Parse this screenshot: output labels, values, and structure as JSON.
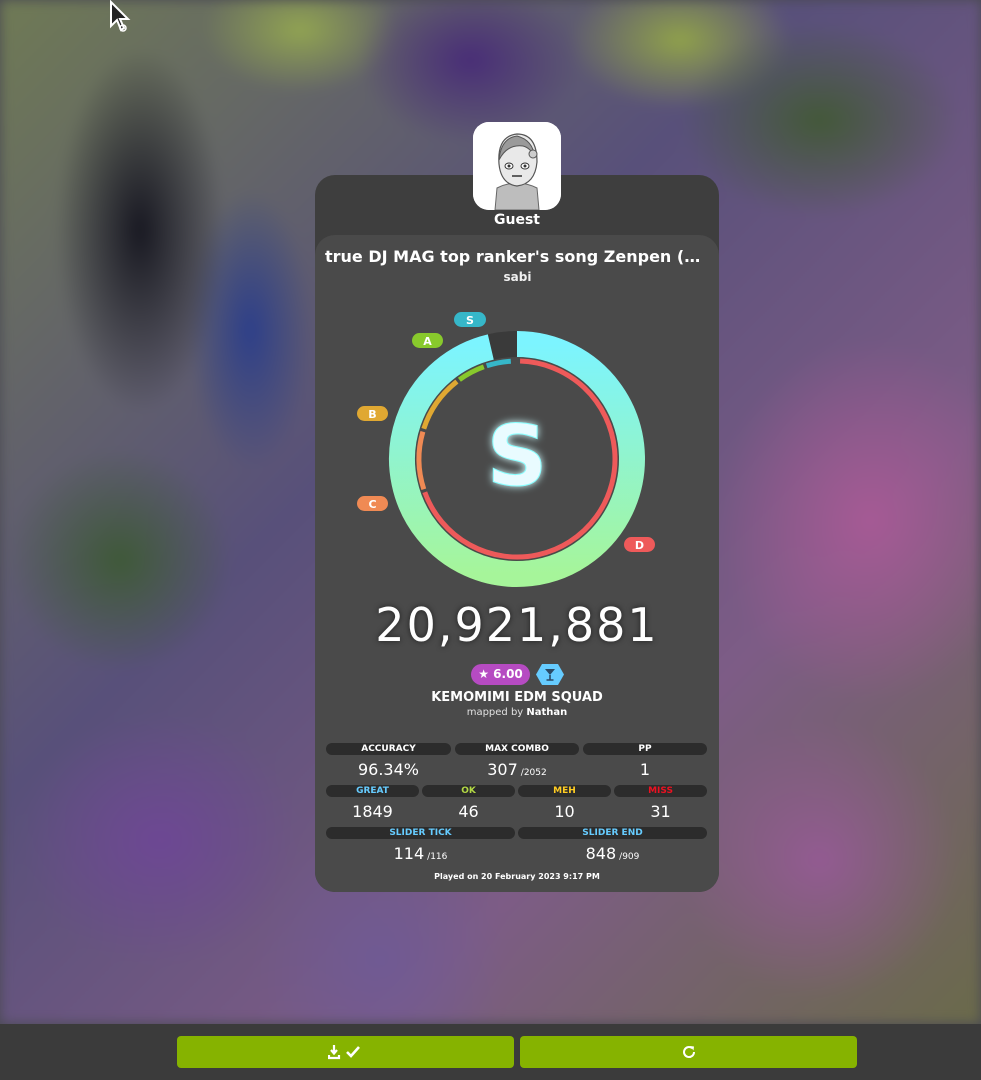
{
  "user": {
    "name": "Guest"
  },
  "beatmap": {
    "title": "true DJ MAG top ranker's song Zenpen (kat...",
    "artist": "sabi",
    "difficulty": "KEMOMIMI EDM SQUAD",
    "mapped_by_label": "mapped by",
    "mapper": "Nathan",
    "star_rating": "6.00"
  },
  "grade": {
    "letter": "S",
    "ring_labels": [
      "S",
      "A",
      "B",
      "C",
      "D"
    ],
    "accuracy_fraction": 0.9634
  },
  "score": "20,921,881",
  "stats": {
    "accuracy": {
      "label": "ACCURACY",
      "value": "96.34%"
    },
    "max_combo": {
      "label": "MAX COMBO",
      "value": "307",
      "max": "/2052"
    },
    "pp": {
      "label": "PP",
      "value": "1"
    },
    "great": {
      "label": "GREAT",
      "value": "1849"
    },
    "ok": {
      "label": "OK",
      "value": "46"
    },
    "meh": {
      "label": "MEH",
      "value": "10"
    },
    "miss": {
      "label": "MISS",
      "value": "31"
    },
    "slider_tick": {
      "label": "SLIDER TICK",
      "value": "114",
      "max": "/116"
    },
    "slider_end": {
      "label": "SLIDER END",
      "value": "848",
      "max": "/909"
    }
  },
  "played_on": "Played on 20 February 2023 9:17 PM",
  "colors": {
    "great": "#66ccff",
    "ok": "#b3d944",
    "meh": "#ffcc22",
    "miss": "#ed1121",
    "button": "#86b300",
    "star_badge": "#b64bc2"
  },
  "footer": {
    "left_button_icon": "download-check-icon",
    "right_button_icon": "retry-icon"
  }
}
